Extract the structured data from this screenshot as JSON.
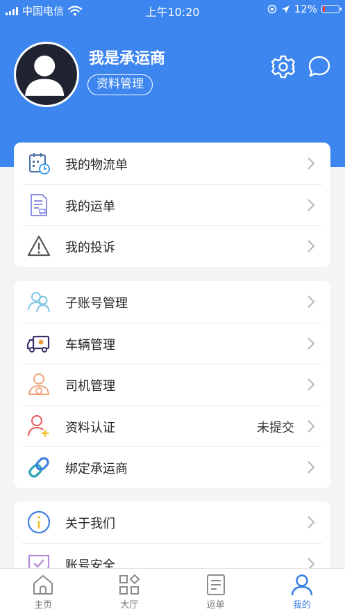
{
  "status_bar": {
    "carrier": "中国电信",
    "time": "上午10:20",
    "battery_text": "12%",
    "battery_level": 0.12
  },
  "profile": {
    "name": "我是承运商",
    "manage_button": "资料管理"
  },
  "icons": {
    "settings": "gear-icon",
    "messages": "chat-bubble-icon"
  },
  "colors": {
    "brand": "#3d86ef",
    "active_tab": "#2f7ae5",
    "battery_low": "#ff3b30"
  },
  "group1": [
    {
      "label": "我的物流单",
      "icon": "calendar-clock-icon"
    },
    {
      "label": "我的运单",
      "icon": "document-truck-icon"
    },
    {
      "label": "我的投诉",
      "icon": "warning-icon"
    }
  ],
  "group2": [
    {
      "label": "子账号管理",
      "icon": "users-icon"
    },
    {
      "label": "车辆管理",
      "icon": "truck-icon"
    },
    {
      "label": "司机管理",
      "icon": "driver-icon"
    },
    {
      "label": "资料认证",
      "value": "未提交",
      "icon": "user-plus-icon"
    },
    {
      "label": "绑定承运商",
      "icon": "link-icon"
    }
  ],
  "group3": [
    {
      "label": "关于我们",
      "icon": "info-icon"
    },
    {
      "label": "账号安全",
      "icon": "shield-check-icon"
    }
  ],
  "tabs": [
    {
      "label": "主页",
      "icon": "home-icon",
      "active": false
    },
    {
      "label": "大厅",
      "icon": "grid-icon",
      "active": false
    },
    {
      "label": "运单",
      "icon": "document-icon",
      "active": false
    },
    {
      "label": "我的",
      "icon": "person-icon",
      "active": true
    }
  ]
}
